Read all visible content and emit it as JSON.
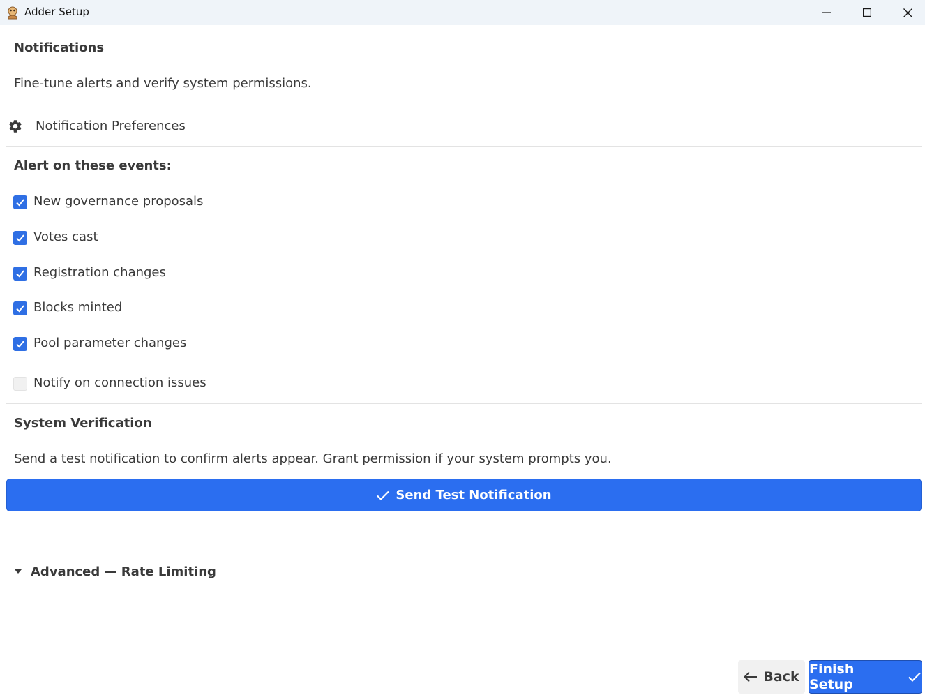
{
  "window": {
    "title": "Adder Setup",
    "controls": [
      "minimize",
      "maximize",
      "close"
    ]
  },
  "page": {
    "heading": "Notifications",
    "description": "Fine-tune alerts and verify system permissions."
  },
  "preferences": {
    "section_label": "Notification Preferences",
    "events_heading": "Alert on these events:",
    "events": [
      {
        "label": "New governance proposals",
        "checked": true
      },
      {
        "label": "Votes cast",
        "checked": true
      },
      {
        "label": "Registration changes",
        "checked": true
      },
      {
        "label": "Blocks minted",
        "checked": true
      },
      {
        "label": "Pool parameter changes",
        "checked": true
      }
    ],
    "connection_issues": {
      "label": "Notify on connection issues",
      "checked": false
    }
  },
  "verification": {
    "heading": "System Verification",
    "description": "Send a test notification to confirm alerts appear. Grant permission if your system prompts you.",
    "button_label": "Send Test Notification"
  },
  "advanced": {
    "label": "Advanced — Rate Limiting",
    "expanded": false
  },
  "footer": {
    "back_label": "Back",
    "finish_label": "Finish Setup"
  },
  "colors": {
    "accent": "#2b6ef0",
    "titlebar": "#eff4f9",
    "divider": "#e3e3e3"
  }
}
